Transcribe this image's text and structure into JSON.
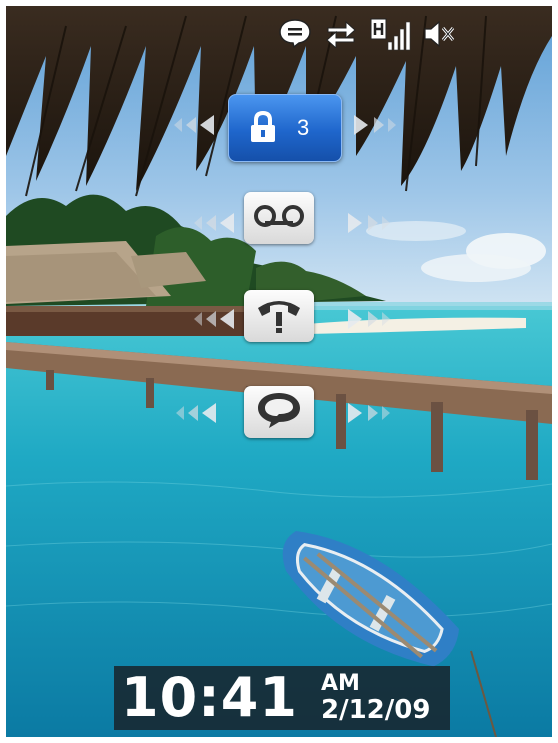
{
  "wallpaper": {
    "sky_top": "#5e9fd6",
    "sky_bottom": "#cfe3f2",
    "sea_light": "#3cc6d6",
    "sea_deep": "#0c7fa8"
  },
  "status_bar": {
    "icons": [
      "notification-bubble-icon",
      "data-transfer-icon",
      "hspa-signal-icon",
      "signal-strength-icon",
      "speaker-muted-icon"
    ]
  },
  "lock_screen": {
    "unlock_slider": {
      "icon": "lock-icon",
      "count": "3",
      "accent": "#1f66cc"
    },
    "notification_rows": [
      {
        "name": "voicemail",
        "icon": "voicemail-icon"
      },
      {
        "name": "missed-call",
        "icon": "missed-call-icon"
      },
      {
        "name": "messages",
        "icon": "message-bubble-icon"
      }
    ]
  },
  "clock": {
    "time": "10:41",
    "ampm": "AM",
    "date": "2/12/09"
  }
}
